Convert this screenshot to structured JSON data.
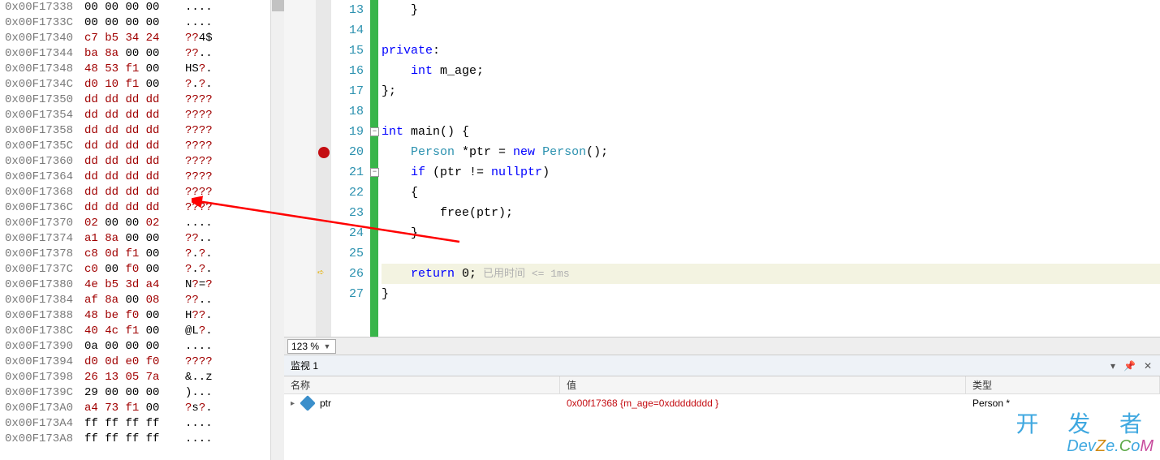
{
  "memory": {
    "rows": [
      {
        "addr": "0x00F17338",
        "b": [
          "00",
          "00",
          "00",
          "00"
        ],
        "a": [
          "...."
        ],
        "special": false
      },
      {
        "addr": "0x00F1733C",
        "b": [
          "00",
          "00",
          "00",
          "00"
        ],
        "a": [
          "...."
        ],
        "special": false
      },
      {
        "addr": "0x00F17340",
        "b": [
          "c7",
          "b5",
          "34",
          "24"
        ],
        "a": [
          "??4$"
        ],
        "special": true
      },
      {
        "addr": "0x00F17344",
        "b": [
          "ba",
          "8a",
          "00",
          "00"
        ],
        "a": [
          "??.."
        ],
        "special": true
      },
      {
        "addr": "0x00F17348",
        "b": [
          "48",
          "53",
          "f1",
          "00"
        ],
        "a": [
          "HS?."
        ],
        "special": true
      },
      {
        "addr": "0x00F1734C",
        "b": [
          "d0",
          "10",
          "f1",
          "00"
        ],
        "a": [
          "?.?."
        ],
        "special": true
      },
      {
        "addr": "0x00F17350",
        "b": [
          "dd",
          "dd",
          "dd",
          "dd"
        ],
        "a": [
          "????"
        ],
        "special": true
      },
      {
        "addr": "0x00F17354",
        "b": [
          "dd",
          "dd",
          "dd",
          "dd"
        ],
        "a": [
          "????"
        ],
        "special": true
      },
      {
        "addr": "0x00F17358",
        "b": [
          "dd",
          "dd",
          "dd",
          "dd"
        ],
        "a": [
          "????"
        ],
        "special": true
      },
      {
        "addr": "0x00F1735C",
        "b": [
          "dd",
          "dd",
          "dd",
          "dd"
        ],
        "a": [
          "????"
        ],
        "special": true
      },
      {
        "addr": "0x00F17360",
        "b": [
          "dd",
          "dd",
          "dd",
          "dd"
        ],
        "a": [
          "????"
        ],
        "special": true
      },
      {
        "addr": "0x00F17364",
        "b": [
          "dd",
          "dd",
          "dd",
          "dd"
        ],
        "a": [
          "????"
        ],
        "special": true
      },
      {
        "addr": "0x00F17368",
        "b": [
          "dd",
          "dd",
          "dd",
          "dd"
        ],
        "a": [
          "????"
        ],
        "special": true
      },
      {
        "addr": "0x00F1736C",
        "b": [
          "dd",
          "dd",
          "dd",
          "dd"
        ],
        "a": [
          "????"
        ],
        "special": true
      },
      {
        "addr": "0x00F17370",
        "b": [
          "02",
          "00",
          "00",
          "02"
        ],
        "a": [
          "...."
        ],
        "special": true
      },
      {
        "addr": "0x00F17374",
        "b": [
          "a1",
          "8a",
          "00",
          "00"
        ],
        "a": [
          "??.."
        ],
        "special": true
      },
      {
        "addr": "0x00F17378",
        "b": [
          "c8",
          "0d",
          "f1",
          "00"
        ],
        "a": [
          "?.?."
        ],
        "special": true
      },
      {
        "addr": "0x00F1737C",
        "b": [
          "c0",
          "00",
          "f0",
          "00"
        ],
        "a": [
          "?.?."
        ],
        "special": true
      },
      {
        "addr": "0x00F17380",
        "b": [
          "4e",
          "b5",
          "3d",
          "a4"
        ],
        "a": [
          "N?=?"
        ],
        "special": true
      },
      {
        "addr": "0x00F17384",
        "b": [
          "af",
          "8a",
          "00",
          "08"
        ],
        "a": [
          "??.."
        ],
        "special": true
      },
      {
        "addr": "0x00F17388",
        "b": [
          "48",
          "be",
          "f0",
          "00"
        ],
        "a": [
          "H??."
        ],
        "special": true
      },
      {
        "addr": "0x00F1738C",
        "b": [
          "40",
          "4c",
          "f1",
          "00"
        ],
        "a": [
          "@L?."
        ],
        "special": true
      },
      {
        "addr": "0x00F17390",
        "b": [
          "0a",
          "00",
          "00",
          "00"
        ],
        "a": [
          "...."
        ],
        "special": false
      },
      {
        "addr": "0x00F17394",
        "b": [
          "d0",
          "0d",
          "e0",
          "f0"
        ],
        "a": [
          "????"
        ],
        "special": true
      },
      {
        "addr": "0x00F17398",
        "b": [
          "26",
          "13",
          "05",
          "7a"
        ],
        "a": [
          "&..z"
        ],
        "special": true
      },
      {
        "addr": "0x00F1739C",
        "b": [
          "29",
          "00",
          "00",
          "00"
        ],
        "a": [
          ")..."
        ],
        "special": false
      },
      {
        "addr": "0x00F173A0",
        "b": [
          "a4",
          "73",
          "f1",
          "00"
        ],
        "a": [
          "?s?."
        ],
        "special": true
      },
      {
        "addr": "0x00F173A4",
        "b": [
          "ff",
          "ff",
          "ff",
          "ff"
        ],
        "a": [
          "...."
        ],
        "special": false
      },
      {
        "addr": "0x00F173A8",
        "b": [
          "ff",
          "ff",
          "ff",
          "ff"
        ],
        "a": [
          "...."
        ],
        "special": false
      }
    ]
  },
  "code": {
    "lines": [
      {
        "n": 13,
        "html": "    }"
      },
      {
        "n": 14,
        "html": ""
      },
      {
        "n": 15,
        "html": "<span class='kw'>private</span>:"
      },
      {
        "n": 16,
        "html": "    <span class='kw'>int</span> m_age;"
      },
      {
        "n": 17,
        "html": "};"
      },
      {
        "n": 18,
        "html": ""
      },
      {
        "n": 19,
        "html": "<span class='kw'>int</span> main() {",
        "fold": true
      },
      {
        "n": 20,
        "html": "    <span class='type'>Person</span> *ptr = <span class='kw'>new</span> <span class='type'>Person</span>();",
        "bp": true
      },
      {
        "n": 21,
        "html": "    <span class='kw'>if</span> (ptr != <span class='kw'>nullptr</span>)",
        "fold": true
      },
      {
        "n": 22,
        "html": "    {"
      },
      {
        "n": 23,
        "html": "        free(ptr);"
      },
      {
        "n": 24,
        "html": "    }"
      },
      {
        "n": 25,
        "html": ""
      },
      {
        "n": 26,
        "html": "    <span class='kw'>return</span> 0;",
        "cur": true,
        "ghost": "已用时间 <= 1ms"
      },
      {
        "n": 27,
        "html": "}"
      }
    ]
  },
  "zoom": {
    "label": "123 %"
  },
  "watch": {
    "title": "监视 1",
    "headers": {
      "name": "名称",
      "value": "值",
      "type": "类型"
    },
    "rows": [
      {
        "name": "ptr",
        "value": "0x00f17368 {m_age=0xdddddddd }",
        "type": "Person *"
      }
    ]
  },
  "watermark": {
    "line1": "开 发 者",
    "line2": "DevZe.CoM"
  }
}
